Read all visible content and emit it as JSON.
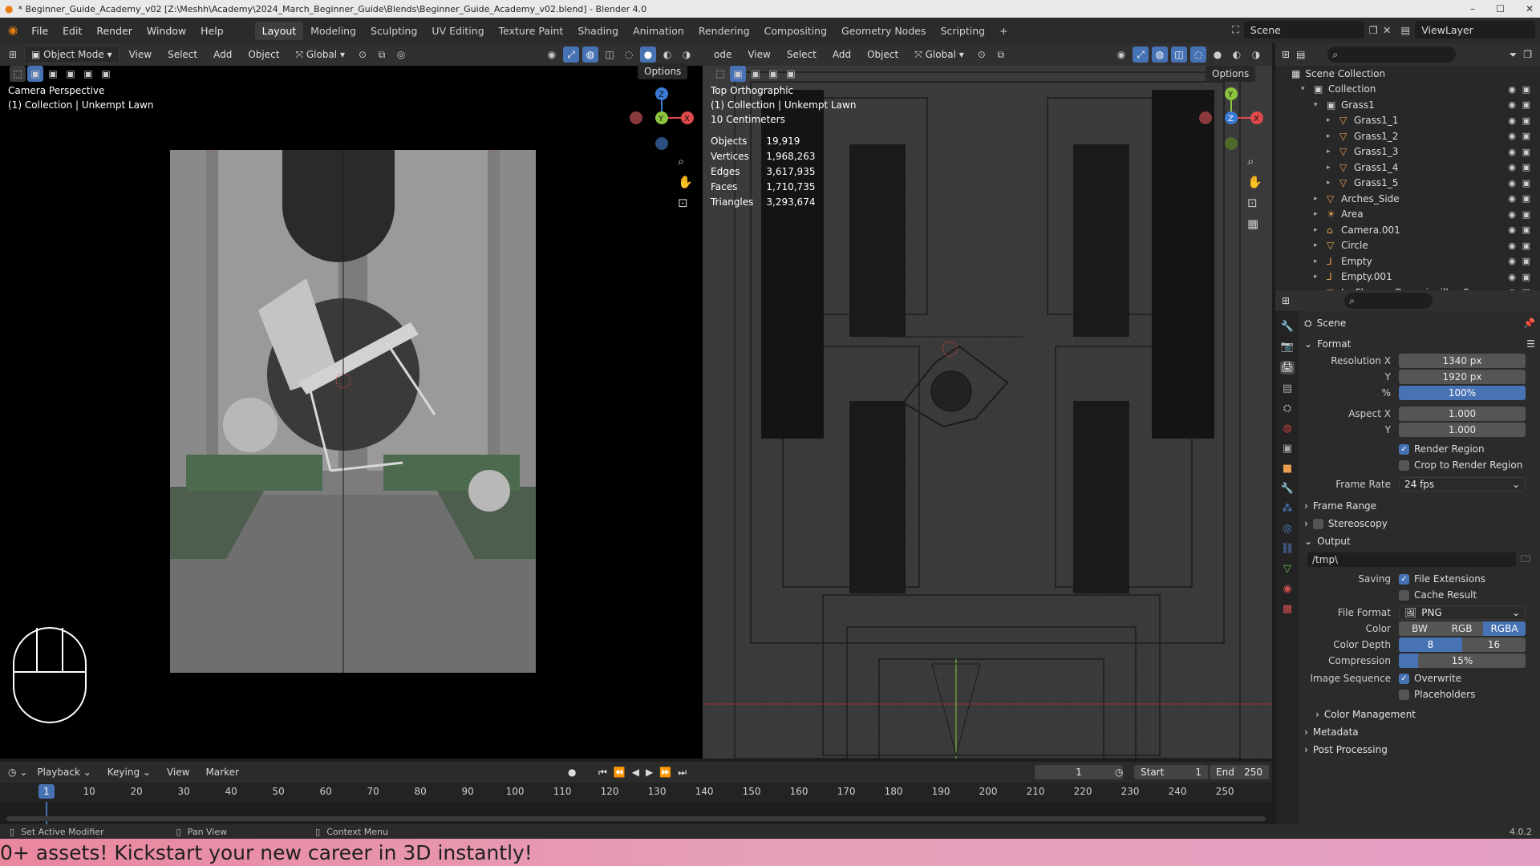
{
  "window": {
    "title": "* Beginner_Guide_Academy_v02 [Z:\\Meshh\\Academy\\2024_March_Beginner_Guide\\Blends\\Beginner_Guide_Academy_v02.blend] - Blender 4.0",
    "controls": [
      "–",
      "☐",
      "✕"
    ]
  },
  "menu": {
    "items": [
      "File",
      "Edit",
      "Render",
      "Window",
      "Help"
    ],
    "workspaces": [
      "Layout",
      "Modeling",
      "Sculpting",
      "UV Editing",
      "Texture Paint",
      "Shading",
      "Animation",
      "Rendering",
      "Compositing",
      "Geometry Nodes",
      "Scripting"
    ],
    "active_workspace": "Layout",
    "add_tab": "+",
    "scene_label": "Scene",
    "viewlayer_label": "ViewLayer"
  },
  "left_view": {
    "mode": "Object Mode",
    "menus": [
      "View",
      "Select",
      "Add",
      "Object"
    ],
    "orientation": "Global",
    "options": "Options",
    "title": "Camera Perspective",
    "subtitle": "(1) Collection | Unkempt Lawn"
  },
  "right_view": {
    "mode_partial": "ode",
    "menus": [
      "View",
      "Select",
      "Add",
      "Object"
    ],
    "orientation": "Global",
    "options": "Options",
    "title": "Top Orthographic",
    "subtitle": "(1) Collection | Unkempt Lawn",
    "scale": "10 Centimeters",
    "stats": [
      {
        "label": "Objects",
        "value": "19,919"
      },
      {
        "label": "Vertices",
        "value": "1,968,263"
      },
      {
        "label": "Edges",
        "value": "3,617,935"
      },
      {
        "label": "Faces",
        "value": "1,710,735"
      },
      {
        "label": "Triangles",
        "value": "3,293,674"
      }
    ]
  },
  "gizmo": {
    "x": "X",
    "y": "Y",
    "z": "Z"
  },
  "outliner": {
    "root": "Scene Collection",
    "rows": [
      {
        "label": "Collection",
        "depth": 1,
        "icon": "collection-icon",
        "color": "#cfcfcf"
      },
      {
        "label": "Grass1",
        "depth": 2,
        "icon": "collection-icon",
        "color": "#cfcfcf"
      },
      {
        "label": "Grass1_1",
        "depth": 3,
        "icon": "mesh-icon",
        "color": "#e8a050"
      },
      {
        "label": "Grass1_2",
        "depth": 3,
        "icon": "mesh-icon",
        "color": "#e8a050"
      },
      {
        "label": "Grass1_3",
        "depth": 3,
        "icon": "mesh-icon",
        "color": "#e8a050"
      },
      {
        "label": "Grass1_4",
        "depth": 3,
        "icon": "mesh-icon",
        "color": "#e8a050"
      },
      {
        "label": "Grass1_5",
        "depth": 3,
        "icon": "mesh-icon",
        "color": "#e8a050"
      },
      {
        "label": "Arches_Side",
        "depth": 2,
        "icon": "mesh-icon",
        "color": "#e8a050"
      },
      {
        "label": "Area",
        "depth": 2,
        "icon": "light-icon",
        "color": "#e8a050"
      },
      {
        "label": "Camera.001",
        "depth": 2,
        "icon": "camera-icon",
        "color": "#e8a050"
      },
      {
        "label": "Circle",
        "depth": 2,
        "icon": "mesh-icon",
        "color": "#e8a050"
      },
      {
        "label": "Empty",
        "depth": 2,
        "icon": "empty-icon",
        "color": "#e8a050"
      },
      {
        "label": "Empty.001",
        "depth": 2,
        "icon": "empty-icon",
        "color": "#e8a050"
      },
      {
        "label": "IvyFlowers Bougainvillea Square",
        "depth": 2,
        "icon": "mesh-icon",
        "color": "#e8a050"
      }
    ]
  },
  "properties": {
    "context": "Scene",
    "format_title": "Format",
    "resolution_x_label": "Resolution X",
    "resolution_x": "1340 px",
    "resolution_y_label": "Y",
    "resolution_y": "1920 px",
    "percent_label": "%",
    "percent": "100%",
    "aspect_x_label": "Aspect X",
    "aspect_x": "1.000",
    "aspect_y_label": "Y",
    "aspect_y": "1.000",
    "render_region": "Render Region",
    "crop_region": "Crop to Render Region",
    "frame_rate_label": "Frame Rate",
    "frame_rate": "24 fps",
    "frame_range": "Frame Range",
    "stereoscopy": "Stereoscopy",
    "output_title": "Output",
    "output_path": "/tmp\\",
    "saving_label": "Saving",
    "file_extensions": "File Extensions",
    "cache_result": "Cache Result",
    "file_format_label": "File Format",
    "file_format": "PNG",
    "color_label": "Color",
    "color_options": [
      "BW",
      "RGB",
      "RGBA"
    ],
    "color_selected": "RGBA",
    "color_depth_label": "Color Depth",
    "color_depth_options": [
      "8",
      "16"
    ],
    "compression_label": "Compression",
    "compression": "15%",
    "compression_fraction": 0.15,
    "image_sequence_label": "Image Sequence",
    "overwrite": "Overwrite",
    "placeholders": "Placeholders",
    "color_management": "Color Management",
    "metadata": "Metadata",
    "post_processing": "Post Processing"
  },
  "timeline": {
    "menus": [
      "Playback",
      "Keying",
      "View",
      "Marker"
    ],
    "current_frame": "1",
    "start_label": "Start",
    "start": "1",
    "end_label": "End",
    "end": "250",
    "ticks": [
      "10",
      "20",
      "30",
      "40",
      "50",
      "60",
      "70",
      "80",
      "90",
      "100",
      "110",
      "120",
      "130",
      "140",
      "150",
      "160",
      "170",
      "180",
      "190",
      "200",
      "210",
      "220",
      "230",
      "240",
      "250"
    ],
    "playhead": "1"
  },
  "status": {
    "left": "Set Active Modifier",
    "middle": "Pan View",
    "right": "Context Menu",
    "version": "4.0.2"
  },
  "banner": {
    "text": "0+ assets! Kickstart your new career in 3D instantly!"
  }
}
